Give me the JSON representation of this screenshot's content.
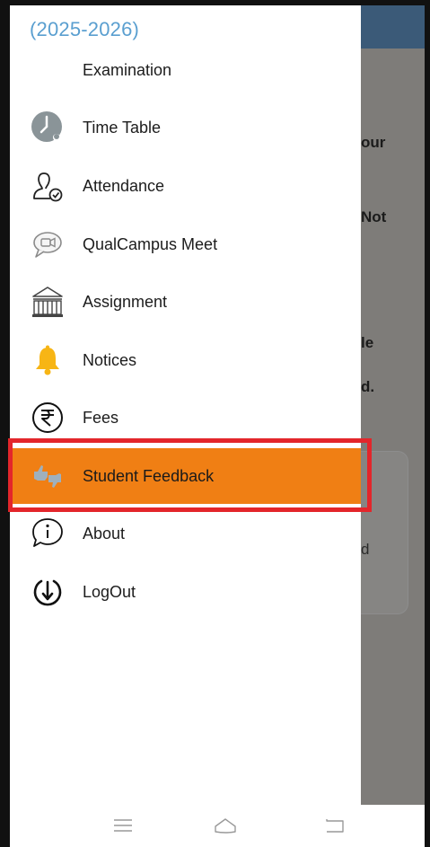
{
  "drawer": {
    "year": "(2025-2026)",
    "items": [
      {
        "label": "Examination",
        "icon": "exam-icon"
      },
      {
        "label": "Time Table",
        "icon": "clock-icon"
      },
      {
        "label": "Attendance",
        "icon": "attendance-icon"
      },
      {
        "label": "QualCampus Meet",
        "icon": "video-chat-icon"
      },
      {
        "label": "Assignment",
        "icon": "building-icon"
      },
      {
        "label": "Notices",
        "icon": "bell-icon"
      },
      {
        "label": "Fees",
        "icon": "rupee-icon"
      },
      {
        "label": "Student Feedback",
        "icon": "feedback-icon",
        "active": true
      },
      {
        "label": "About",
        "icon": "info-icon"
      },
      {
        "label": "LogOut",
        "icon": "logout-icon"
      }
    ],
    "active_color": "#f07f14",
    "highlight_color": "#e3262b",
    "year_color": "#5a9fd0"
  },
  "background_app": {
    "fragments": [
      "our",
      "Not",
      "le",
      "d.",
      "d"
    ]
  },
  "navbar": {
    "buttons": [
      "menu-icon",
      "home-icon",
      "back-icon"
    ]
  }
}
